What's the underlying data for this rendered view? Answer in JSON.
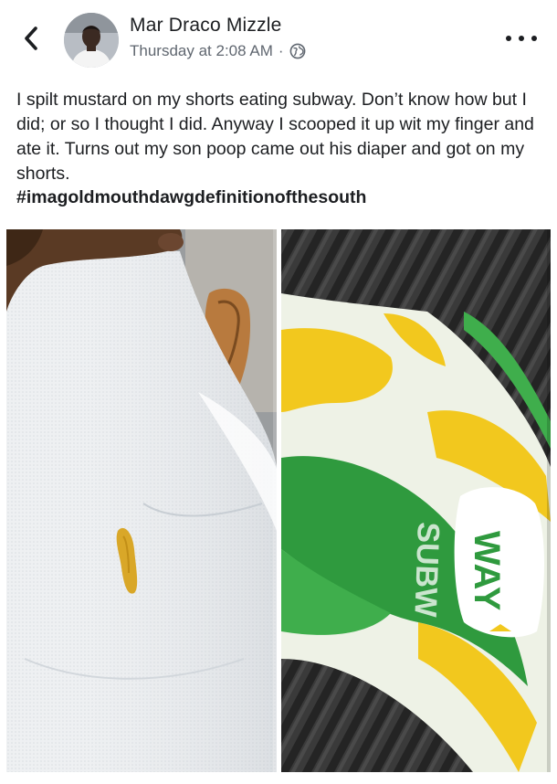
{
  "post": {
    "author": "Mar Draco Mizzle",
    "timestamp": "Thursday at 2:08 AM",
    "separator": "·",
    "privacy_icon": "globe-icon",
    "body_text": "I spilt mustard on my shorts eating subway. Don’t know how but I did; or so I thought I did. Anyway I scooped it up wit my finger and ate it. Turns out my son poop came out his diaper and got on my shorts.",
    "hashtag": "#imagoldmouthdawgdefinitionofthesouth"
  },
  "icons": {
    "back": "chevron-left-icon",
    "more": "more-dots-icon"
  },
  "photos": [
    {
      "name": "photo-white-shorts-stain",
      "subject": "white shorts with yellow stain"
    },
    {
      "name": "photo-subway-wrapper",
      "subject": "subway sandwich wrapper",
      "wrapper_text": "WAY"
    }
  ],
  "colors": {
    "text": "#1c1e21",
    "secondary": "#606770",
    "subway_green": "#2f9a3e",
    "subway_yellow": "#f2c81e",
    "stain": "#d9a728"
  }
}
